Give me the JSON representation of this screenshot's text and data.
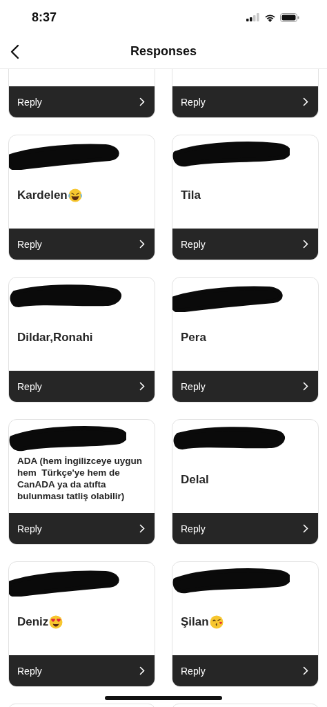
{
  "status_bar": {
    "time": "8:37"
  },
  "header": {
    "title": "Responses"
  },
  "responses": [
    {
      "kind": "cut-top",
      "reply_label": "Reply"
    },
    {
      "kind": "cut-top",
      "reply_label": "Reply"
    },
    {
      "kind": "full",
      "username_redacted": true,
      "text": "Kardelen",
      "emoji": {
        "kind": "laugh"
      },
      "reply_label": "Reply"
    },
    {
      "kind": "full",
      "username_redacted": true,
      "text": "Tila",
      "reply_label": "Reply"
    },
    {
      "kind": "full",
      "username_redacted": true,
      "text": "Dildar,Ronahi",
      "reply_label": "Reply"
    },
    {
      "kind": "full",
      "username_redacted": true,
      "text": "Pera",
      "reply_label": "Reply"
    },
    {
      "kind": "long",
      "username_redacted": true,
      "text": "ADA (hem İngilizceye uygun hem  Türkçe'ye hem de CanADA ya da atıfta bulunması tatliş olabilir)",
      "reply_label": "Reply"
    },
    {
      "kind": "full",
      "username_redacted": true,
      "text": "Delal",
      "reply_label": "Reply"
    },
    {
      "kind": "full",
      "username_redacted": true,
      "text": "Deniz",
      "emoji": {
        "kind": "heart-eyes"
      },
      "reply_label": "Reply"
    },
    {
      "kind": "full",
      "username_redacted": true,
      "text": "Şilan",
      "emoji": {
        "kind": "kiss"
      },
      "reply_label": "Reply"
    },
    {
      "kind": "cut-bottom"
    },
    {
      "kind": "cut-bottom"
    }
  ]
}
